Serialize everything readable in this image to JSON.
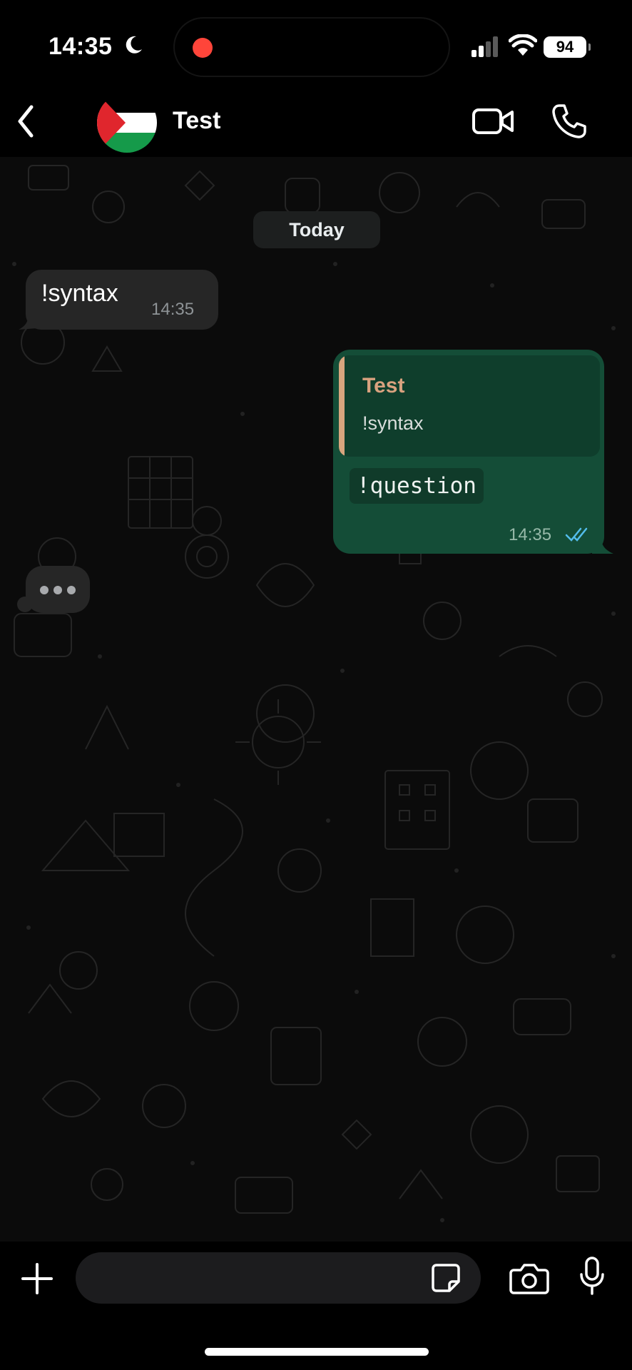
{
  "status_bar": {
    "time": "14:35",
    "battery": "94"
  },
  "header": {
    "contact_name": "Test"
  },
  "chat": {
    "date_separator": "Today",
    "messages": [
      {
        "direction": "incoming",
        "text": "!syntax",
        "time": "14:35"
      },
      {
        "direction": "outgoing",
        "quoted_author": "Test",
        "quoted_text": "!syntax",
        "text": "!question",
        "time": "14:35",
        "read": true
      }
    ],
    "typing_indicator": true
  },
  "colors": {
    "outgoing_bubble": "#144d37",
    "incoming_bubble": "#262626",
    "quote_accent": "#d8a57e",
    "read_ticks": "#53bdeb",
    "recording_dot": "#ff453a"
  },
  "icons": {
    "back": "chevron-left-icon",
    "video": "video-camera-icon",
    "call": "phone-icon",
    "attach": "plus-icon",
    "sticker": "sticker-icon",
    "camera": "camera-icon",
    "mic": "microphone-icon"
  }
}
